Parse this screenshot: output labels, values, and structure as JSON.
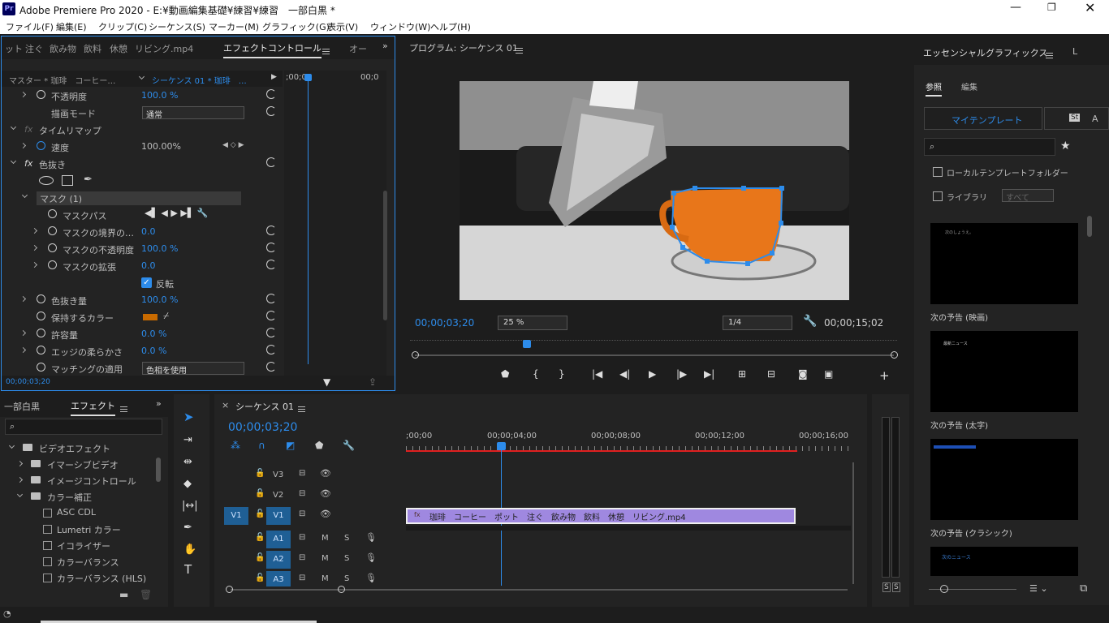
{
  "window": {
    "title": "Adobe Premiere Pro 2020 - E:¥動画編集基礎¥練習¥練習　一部白黒 *",
    "app_icon": "Pr"
  },
  "menu": [
    "ファイル(F)",
    "編集(E)",
    "クリップ(C)",
    "シーケンス(S)",
    "マーカー(M)",
    "グラフィック(G)",
    "表示(V)",
    "ウィンドウ(W)",
    "ヘルプ(H)"
  ],
  "effect_panel": {
    "tabs": [
      "ット",
      "注ぐ",
      "飲み物",
      "飲料",
      "休憩",
      "リビング.mp4"
    ],
    "active_tab": "エフェクトコントロール",
    "extra_tab": "オー",
    "master_label": "マスター * 珈琲　コーヒー…",
    "sequence_label": "シーケンス 01 * 珈琲　…",
    "ruler_start": ";00;00",
    "ruler_end": "00;0",
    "rows": {
      "opacity": {
        "label": "不透明度",
        "value": "100.0 %"
      },
      "blend": {
        "label": "描画モード",
        "value": "通常"
      },
      "timeremap": {
        "label": "タイムリマップ"
      },
      "speed": {
        "label": "速度",
        "value": "100.00%"
      },
      "color_key": {
        "label": "色抜き"
      },
      "mask": {
        "label": "マスク (1)"
      },
      "mask_path": {
        "label": "マスクパス"
      },
      "mask_feather": {
        "label": "マスクの境界の…",
        "value": "0.0"
      },
      "mask_opacity": {
        "label": "マスクの不透明度",
        "value": "100.0 %"
      },
      "mask_expand": {
        "label": "マスクの拡張",
        "value": "0.0"
      },
      "invert": {
        "label": "反転"
      },
      "amount": {
        "label": "色抜き量",
        "value": "100.0 %"
      },
      "keep_color": {
        "label": "保持するカラー",
        "color": "#c86a00"
      },
      "tolerance": {
        "label": "許容量",
        "value": "0.0 %"
      },
      "edge": {
        "label": "エッジの柔らかさ",
        "value": "0.0 %"
      },
      "match": {
        "label": "マッチングの適用",
        "value": "色相を使用"
      }
    },
    "timecode": "00;00;03;20"
  },
  "program": {
    "title": "プログラム: シーケンス 01",
    "timecode": "00;00;03;20",
    "zoom": "25 %",
    "resolution": "1/4",
    "duration": "00;00;15;02"
  },
  "effects_panel": {
    "tab1": "一部白黒",
    "tab2": "エフェクト",
    "items": [
      "ビデオエフェクト",
      "イマーシブビデオ",
      "イメージコントロール",
      "カラー補正",
      "ASC CDL",
      "Lumetri カラー",
      "イコライザー",
      "カラーバランス",
      "カラーバランス (HLS)"
    ]
  },
  "timeline": {
    "title": "シーケンス 01",
    "timecode": "00;00;03;20",
    "ruler": [
      ";00;00",
      "00;00;04;00",
      "00;00;08;00",
      "00;00;12;00",
      "00;00;16;00"
    ],
    "tracks": [
      "V3",
      "V2",
      "V1",
      "A1",
      "A2",
      "A3"
    ],
    "source_v": "V1",
    "clip": "珈琲　コーヒー　ポット　注ぐ　飲み物　飲料　休憩　リビング.mp4"
  },
  "meter": {
    "labels": [
      "S",
      "S"
    ]
  },
  "graphics": {
    "title": "エッセンシャルグラフィックス",
    "extra_tab": "L",
    "tab_browse": "参照",
    "tab_edit": "編集",
    "my_templates": "マイテンプレート",
    "st": "St",
    "a": "A",
    "local_folder": "ローカルテンプレートフォルダー",
    "library": "ライブラリ",
    "library_select": "すべて",
    "templates": [
      {
        "name": "次の予告 (映画)",
        "text": "次のしょうえ。"
      },
      {
        "name": "次の予告 (太字)",
        "text": "最新ニュース"
      },
      {
        "name": "次の予告 (クラシック)",
        "text": ""
      },
      {
        "name": "",
        "text": "次のニュース"
      }
    ]
  }
}
